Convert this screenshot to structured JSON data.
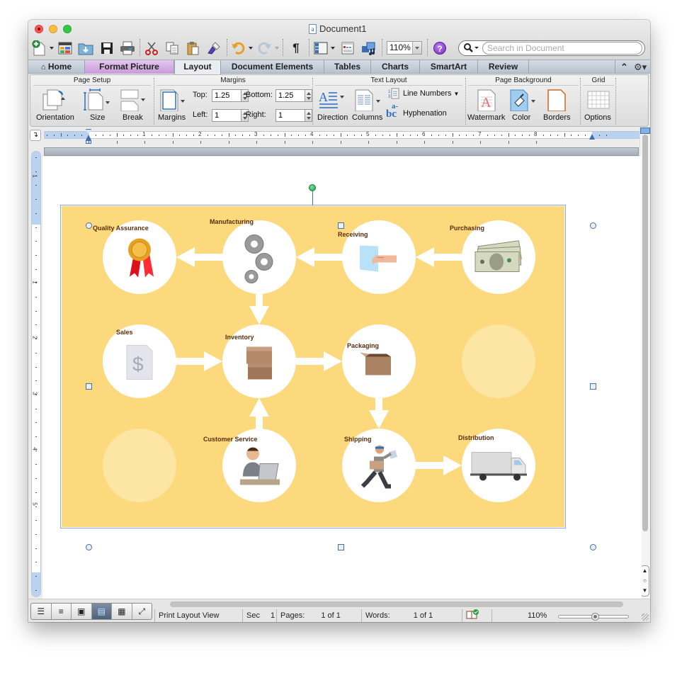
{
  "window": {
    "title": "Document1",
    "traffic_lights": [
      "close",
      "minimize",
      "zoom"
    ]
  },
  "toolbar": {
    "icons": [
      "new-document-icon",
      "gallery-icon",
      "open-icon",
      "save-icon",
      "print-icon",
      "cut-icon",
      "copy-icon",
      "paste-icon",
      "format-painter-icon",
      "undo-icon",
      "redo-icon",
      "show-formatting-icon",
      "sidebar-icon",
      "toolbox-icon",
      "media-browser-icon"
    ],
    "pilcrow": "¶",
    "zoom_value": "110%",
    "help_label": "?",
    "search_placeholder": "Search in Document"
  },
  "tabs": [
    {
      "label": "Home",
      "active": false
    },
    {
      "label": "Format Picture",
      "active": false,
      "contextual": true
    },
    {
      "label": "Layout",
      "active": true
    },
    {
      "label": "Document Elements",
      "active": false
    },
    {
      "label": "Tables",
      "active": false
    },
    {
      "label": "Charts",
      "active": false
    },
    {
      "label": "SmartArt",
      "active": false
    },
    {
      "label": "Review",
      "active": false
    }
  ],
  "ribbon": {
    "groups": {
      "page_setup": "Page Setup",
      "margins": "Margins",
      "text_layout": "Text Layout",
      "page_background": "Page Background",
      "grid": "Grid"
    },
    "buttons": {
      "orientation": "Orientation",
      "size": "Size",
      "break": "Break",
      "margins": "Margins",
      "direction": "Direction",
      "columns": "Columns",
      "line_numbers": "Line Numbers",
      "hyphenation": "Hyphenation",
      "watermark": "Watermark",
      "color": "Color",
      "borders": "Borders",
      "options": "Options"
    },
    "margin_fields": {
      "top_label": "Top:",
      "top_value": "1.25",
      "bottom_label": "Bottom:",
      "bottom_value": "1.25",
      "left_label": "Left:",
      "left_value": "1",
      "right_label": "Right:",
      "right_value": "1"
    }
  },
  "ruler": {
    "h_numbers": [
      "1",
      "2",
      "3",
      "4",
      "5",
      "6",
      "7",
      "8"
    ],
    "v_numbers": [
      "1",
      "1",
      "2",
      "3",
      "4",
      "5"
    ]
  },
  "diagram": {
    "background_color": "#fdd97e",
    "nodes": [
      {
        "id": "quality",
        "label": "Quality Assurance",
        "icon": "award-ribbon-icon"
      },
      {
        "id": "manufacturing",
        "label": "Manufacturing",
        "icon": "gears-icon"
      },
      {
        "id": "receiving",
        "label": "Receiving",
        "icon": "hand-receiving-icon"
      },
      {
        "id": "purchasing",
        "label": "Purchasing",
        "icon": "money-icon"
      },
      {
        "id": "sales",
        "label": "Sales",
        "icon": "dollar-document-icon"
      },
      {
        "id": "inventory",
        "label": "Inventory",
        "icon": "boxes-icon"
      },
      {
        "id": "packaging",
        "label": "Packaging",
        "icon": "open-box-icon"
      },
      {
        "id": "customer_service",
        "label": "Customer Service",
        "icon": "operator-icon"
      },
      {
        "id": "shipping",
        "label": "Shipping",
        "icon": "courier-icon"
      },
      {
        "id": "distribution",
        "label": "Distribution",
        "icon": "truck-icon"
      }
    ],
    "flows": [
      [
        "purchasing",
        "receiving"
      ],
      [
        "receiving",
        "manufacturing"
      ],
      [
        "manufacturing",
        "quality"
      ],
      [
        "manufacturing",
        "inventory"
      ],
      [
        "sales",
        "inventory"
      ],
      [
        "inventory",
        "packaging"
      ],
      [
        "customer_service",
        "inventory"
      ],
      [
        "packaging",
        "shipping"
      ],
      [
        "shipping",
        "distribution"
      ]
    ]
  },
  "statusbar": {
    "view_buttons": [
      "draft-view",
      "outline-view",
      "notebook-view",
      "print-layout-view",
      "publishing-view",
      "full-screen-view"
    ],
    "active_view": "print-layout-view",
    "view_name": "Print Layout View",
    "sec_label": "Sec",
    "sec_value": "1",
    "pages_label": "Pages:",
    "pages_value": "1 of 1",
    "words_label": "Words:",
    "words_value": "1 of 1",
    "zoom_value": "110%",
    "zoom_percent": 110
  }
}
